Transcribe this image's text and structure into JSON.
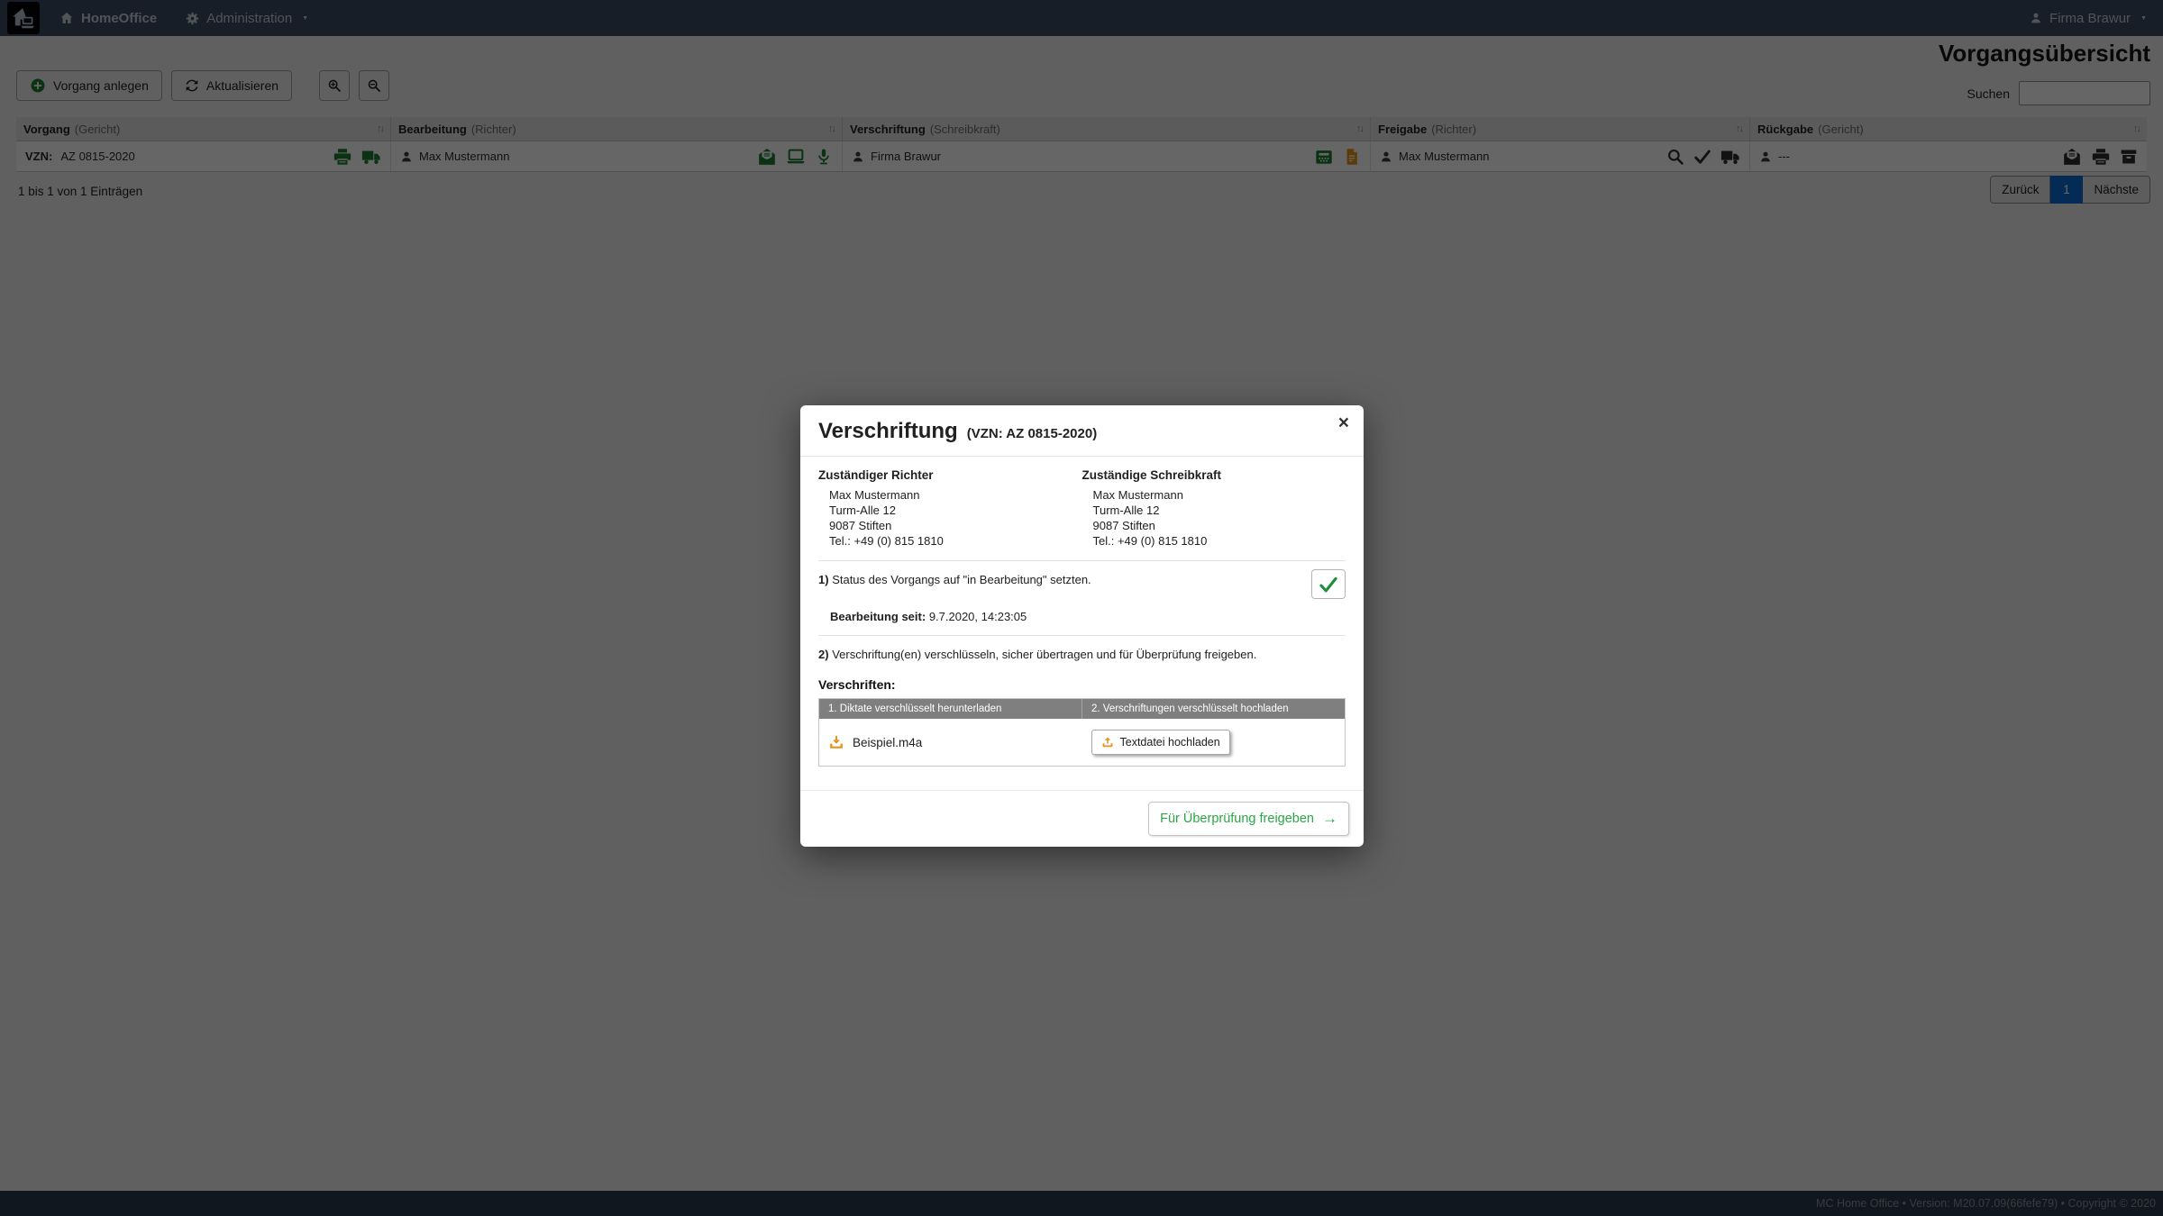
{
  "navbar": {
    "brand": "HomeOffice",
    "menu_administration": "Administration",
    "user": "Firma Brawur"
  },
  "page": {
    "title": "Vorgangsübersicht",
    "search": {
      "label": "Suchen",
      "value": ""
    },
    "toolbar": {
      "create": "Vorgang anlegen",
      "refresh": "Aktualisieren"
    },
    "table": {
      "columns": [
        {
          "title": "Vorgang",
          "subtitle": "(Gericht)"
        },
        {
          "title": "Bearbeitung",
          "subtitle": "(Richter)"
        },
        {
          "title": "Verschriftung",
          "subtitle": "(Schreibkraft)"
        },
        {
          "title": "Freigabe",
          "subtitle": "(Richter)"
        },
        {
          "title": "Rückgabe",
          "subtitle": "(Gericht)"
        }
      ],
      "row": {
        "vzn_label": "VZN:",
        "vzn_value": "AZ 0815-2020",
        "bearbeitung_user": "Max Mustermann",
        "verschriftung_user": "Firma Brawur",
        "freigabe_user": "Max Mustermann",
        "rueckgabe_user": "---"
      }
    },
    "entries_info": "1 bis 1 von 1 Einträgen",
    "pagination": {
      "prev": "Zurück",
      "current": "1",
      "next": "Nächste"
    }
  },
  "modal": {
    "title": "Verschriftung",
    "subtitle": "(VZN: AZ 0815-2020)",
    "close": "×",
    "richter": {
      "heading": "Zuständiger Richter",
      "lines": [
        "Max Mustermann",
        "Turm-Alle 12",
        "9087 Stiften",
        "Tel.: +49 (0) 815 1810"
      ]
    },
    "schreibkraft": {
      "heading": "Zuständige Schreibkraft",
      "lines": [
        "Max Mustermann",
        "Turm-Alle 12",
        "9087 Stiften",
        "Tel.: +49 (0) 815 1810"
      ]
    },
    "step1": {
      "number": "1)",
      "text": "Status des Vorgangs auf \"in Bearbeitung\" setzten.",
      "since_label": "Bearbeitung seit:",
      "since_value": "9.7.2020, 14:23:05"
    },
    "step2": {
      "number": "2)",
      "text": "Verschriftung(en) verschlüsseln, sicher übertragen und für Überprüfung freigeben."
    },
    "verschriften_heading": "Verschriften:",
    "files": {
      "col_download": "1. Diktate verschlüsselt herunterladen",
      "col_upload": "2. Verschriftungen verschlüsselt hochladen",
      "filename": "Beispiel.m4a",
      "upload_button": "Textdatei hochladen"
    },
    "submit": "Für Überprüfung freigeben"
  },
  "footer": {
    "text": "MC Home Office • Version: M20.07.09(66fefe79) • Copyright © 2020"
  },
  "icons": {
    "sort": "↑↓",
    "caret": "▼",
    "close": "×",
    "check": "✓",
    "arrow_right": "→"
  },
  "colors": {
    "navbar_bg": "#3a4c61",
    "accent_green": "#1e7e34",
    "accent_orange": "#e8921a",
    "primary_blue": "#0b6bd4",
    "files_header_bg": "#7f7f7f"
  }
}
